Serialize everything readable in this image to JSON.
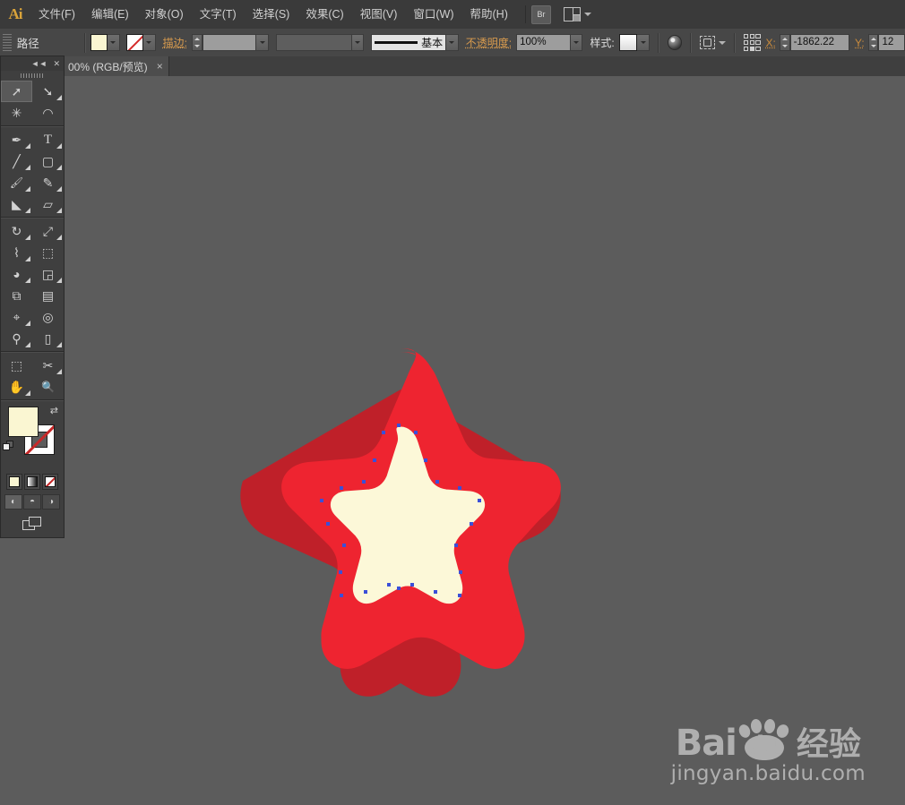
{
  "app": {
    "name": "Ai",
    "logo_color": "#d9a33a"
  },
  "menubar": {
    "items": [
      {
        "label": "文件(F)"
      },
      {
        "label": "编辑(E)"
      },
      {
        "label": "对象(O)"
      },
      {
        "label": "文字(T)"
      },
      {
        "label": "选择(S)"
      },
      {
        "label": "效果(C)"
      },
      {
        "label": "视图(V)"
      },
      {
        "label": "窗口(W)"
      },
      {
        "label": "帮助(H)"
      }
    ],
    "bridge_label": "Br",
    "workspace_icon": "workspace-switcher-icon"
  },
  "controlbar": {
    "title": "路径",
    "fill_label": "fill-swatch",
    "fill_color": "#FAF6D2",
    "stroke_swatch_label": "stroke-none-swatch",
    "stroke_label": "描边:",
    "stroke_weight": "",
    "stroke_profile": "",
    "brush_label": "基本",
    "opacity_label": "不透明度:",
    "opacity_value": "100%",
    "style_label": "样式:",
    "x_label": "X:",
    "x_value": "-1862.22",
    "y_label": "Y:",
    "y_value": "12"
  },
  "tabbar": {
    "document_tab": "00% (RGB/预览)",
    "close_glyph": "×"
  },
  "toolpanel": {
    "collapse_glyph": "◄◄",
    "close_glyph": "✕",
    "tools": [
      {
        "name": "selection-tool",
        "glyph": "➚",
        "active": true,
        "sub": false
      },
      {
        "name": "direct-selection-tool",
        "glyph": "➘",
        "active": false,
        "sub": true
      },
      {
        "name": "magic-wand-tool",
        "glyph": "✳",
        "active": false,
        "sub": false
      },
      {
        "name": "lasso-tool",
        "glyph": "◠",
        "active": false,
        "sub": false
      },
      {
        "name": "pen-tool",
        "glyph": "✒",
        "active": false,
        "sub": true
      },
      {
        "name": "type-tool",
        "glyph": "T",
        "active": false,
        "sub": true
      },
      {
        "name": "line-segment-tool",
        "glyph": "╱",
        "active": false,
        "sub": true
      },
      {
        "name": "rectangle-tool",
        "glyph": "▢",
        "active": false,
        "sub": true
      },
      {
        "name": "paintbrush-tool",
        "glyph": "🖌",
        "active": false,
        "sub": true
      },
      {
        "name": "pencil-tool",
        "glyph": "✎",
        "active": false,
        "sub": true
      },
      {
        "name": "blob-brush-tool",
        "glyph": "◣",
        "active": false,
        "sub": true
      },
      {
        "name": "eraser-tool",
        "glyph": "▱",
        "active": false,
        "sub": true
      },
      {
        "name": "rotate-tool",
        "glyph": "↻",
        "active": false,
        "sub": true
      },
      {
        "name": "scale-tool",
        "glyph": "⤢",
        "active": false,
        "sub": true
      },
      {
        "name": "width-tool",
        "glyph": "⌇",
        "active": false,
        "sub": true
      },
      {
        "name": "free-transform-tool",
        "glyph": "⬚",
        "active": false,
        "sub": false
      },
      {
        "name": "shape-builder-tool",
        "glyph": "◕",
        "active": false,
        "sub": true
      },
      {
        "name": "perspective-grid-tool",
        "glyph": "◲",
        "active": false,
        "sub": true
      },
      {
        "name": "mesh-tool",
        "glyph": "⧉",
        "active": false,
        "sub": false
      },
      {
        "name": "gradient-tool",
        "glyph": "▤",
        "active": false,
        "sub": false
      },
      {
        "name": "eyedropper-tool",
        "glyph": "⌖",
        "active": false,
        "sub": true
      },
      {
        "name": "blend-tool",
        "glyph": "◎",
        "active": false,
        "sub": false
      },
      {
        "name": "symbol-sprayer-tool",
        "glyph": "⚲",
        "active": false,
        "sub": true
      },
      {
        "name": "column-graph-tool",
        "glyph": "▯",
        "active": false,
        "sub": true
      },
      {
        "name": "artboard-tool",
        "glyph": "⬚",
        "active": false,
        "sub": false
      },
      {
        "name": "slice-tool",
        "glyph": "✂",
        "active": false,
        "sub": true
      },
      {
        "name": "hand-tool",
        "glyph": "✋",
        "active": false,
        "sub": true
      },
      {
        "name": "zoom-tool",
        "glyph": "🔍",
        "active": false,
        "sub": false
      }
    ],
    "fill_color": "#FAF6D2",
    "stroke_color": "none",
    "swap_glyph": "⇄",
    "color_modes": [
      {
        "name": "color-mode-button",
        "label": "color"
      },
      {
        "name": "gradient-mode-button",
        "label": "gradient"
      },
      {
        "name": "none-mode-button",
        "label": "none"
      }
    ],
    "draw_modes": [
      {
        "name": "draw-normal-button",
        "glyph": "◐"
      },
      {
        "name": "draw-behind-button",
        "glyph": "◓"
      },
      {
        "name": "draw-inside-button",
        "glyph": "◑"
      }
    ],
    "screen_mode": "screen-mode-button"
  },
  "artwork": {
    "name": "rounded-star-3d",
    "red": "#EE2430",
    "red_shadow": "#BF2029",
    "cream": "#FCF8D8",
    "anchor_color": "#3b4fd8",
    "canvas_bg": "#5c5c5c"
  },
  "watermark": {
    "brand_latin": "Bai",
    "brand_du": "du",
    "brand_cn": "经验",
    "url": "jingyan.baidu.com"
  }
}
